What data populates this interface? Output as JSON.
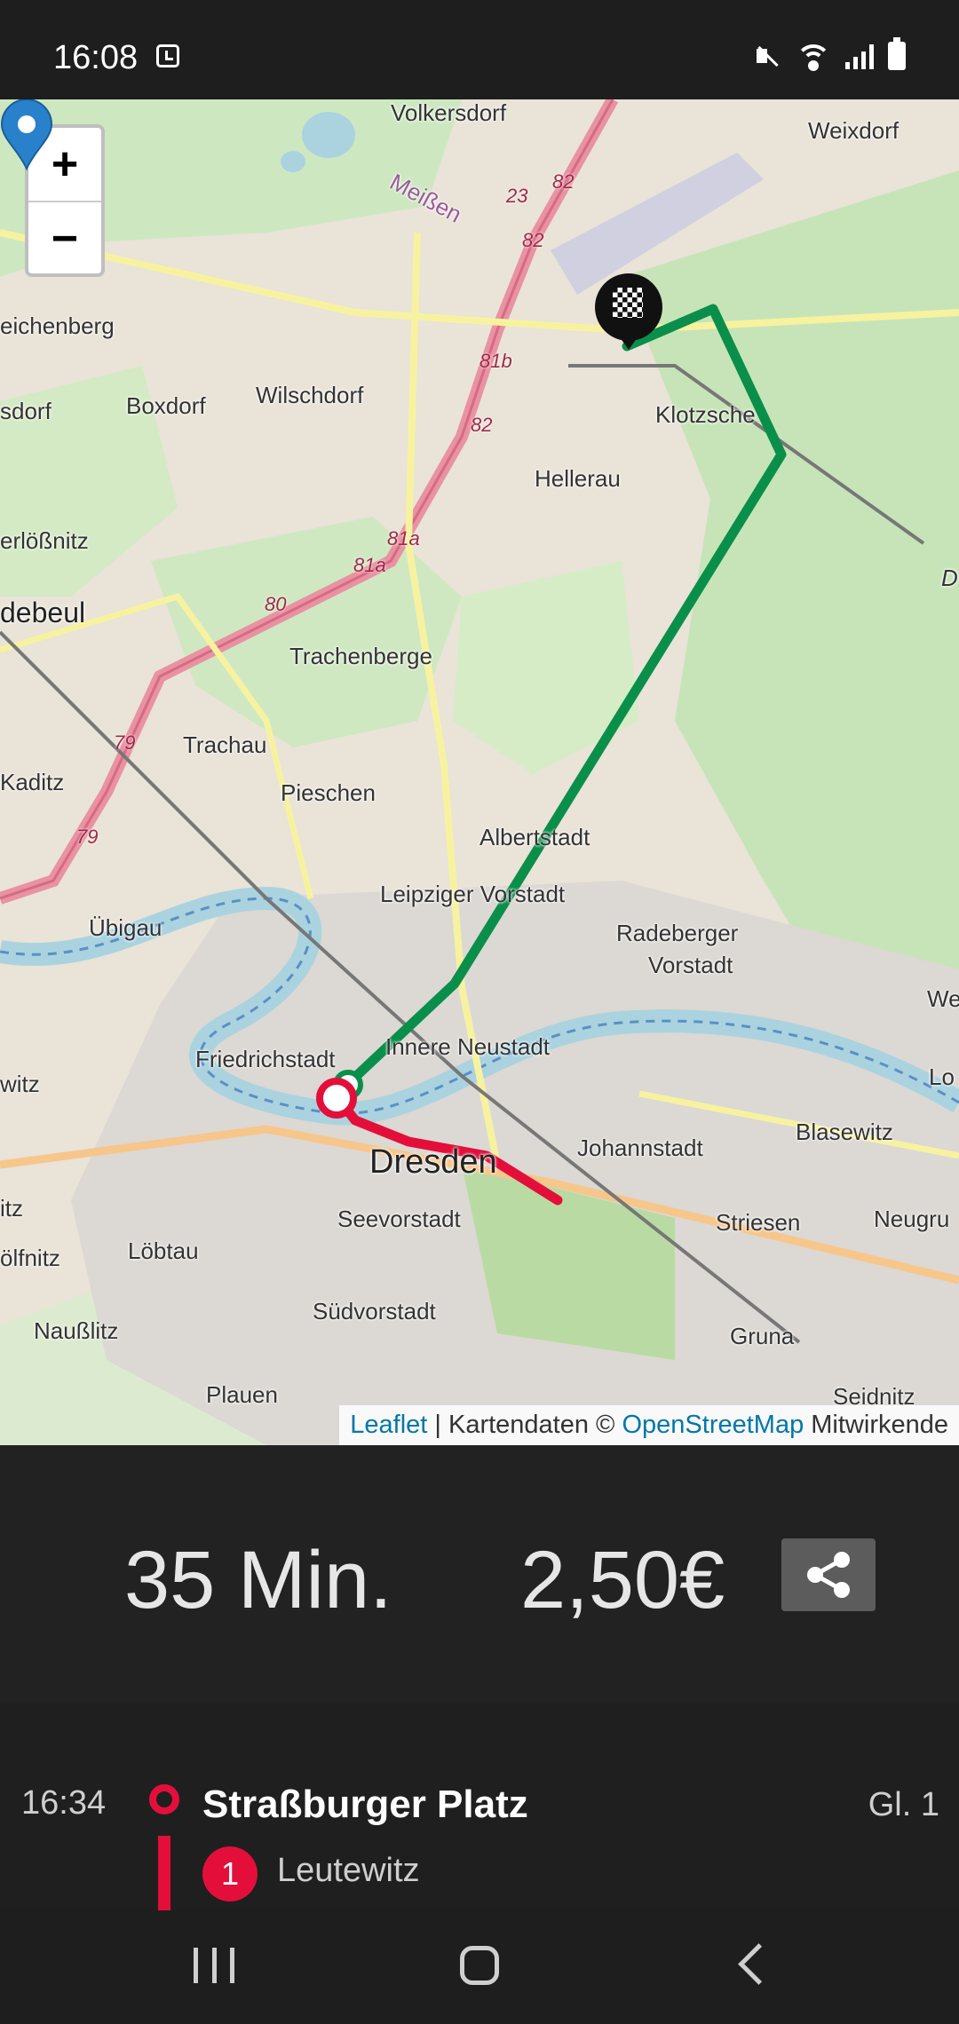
{
  "status_bar": {
    "time": "16:08"
  },
  "map": {
    "labels": [
      "Volkersdorf",
      "Weixdorf",
      "eichenberg",
      "Wilschdorf",
      "Boxdorf",
      "sdorf",
      "Klotzsche",
      "Hellerau",
      "erlößnitz",
      "debeul",
      "Trachenberge",
      "Trachau",
      "Kaditz",
      "Pieschen",
      "Albertstadt",
      "Leipziger Vorstadt",
      "Radeberger",
      "Vorstadt",
      "Übigau",
      "Friedrichstadt",
      "Innere Neustadt",
      "witz",
      "Johannstadt",
      "Blasewitz",
      "Dresden",
      "Seevorstadt",
      "Striesen",
      "Neugru",
      "Löbtau",
      "ölfnitz",
      "Naußlitz",
      "Südvorstadt",
      "Gruna",
      "Plauen",
      "Seidnitz",
      "Meißen",
      "We",
      "Lo",
      "itz",
      "D"
    ],
    "road_numbers": [
      "82",
      "23",
      "82",
      "81b",
      "82",
      "81a",
      "81a",
      "80",
      "79",
      "79"
    ],
    "zoom_in": "+",
    "zoom_out": "−",
    "attribution": {
      "leaflet": "Leaflet",
      "middle": " | Kartendaten © ",
      "osm": "OpenStreetMap",
      "end": " Mitwirkende"
    },
    "colors": {
      "walk_route": "#0a8f4b",
      "tram_route": "#e30f3a",
      "pin": "#2a81cb"
    }
  },
  "summary": {
    "duration": "35 Min.",
    "price": "2,50€",
    "share_icon": "share-icon"
  },
  "leg": {
    "time": "16:34",
    "station": "Straßburger Platz",
    "platform": "Gl. 1",
    "line": "1",
    "direction": "Leutewitz"
  }
}
